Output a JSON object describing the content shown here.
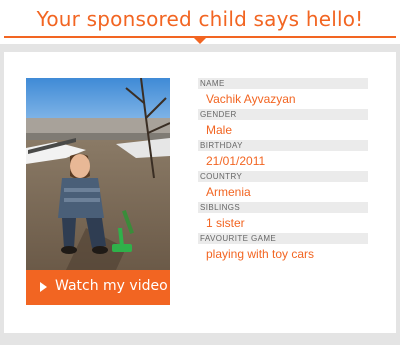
{
  "header": {
    "title": "Your sponsored child says hello!"
  },
  "photo": {
    "alt": "Child playing outdoors with a green toy"
  },
  "video_button": {
    "icon": "play-icon",
    "label": "Watch my video"
  },
  "details": [
    {
      "label": "NAME",
      "value": "Vachik Ayvazyan"
    },
    {
      "label": "GENDER",
      "value": "Male"
    },
    {
      "label": "BIRTHDAY",
      "value": "21/01/2011"
    },
    {
      "label": "COUNTRY",
      "value": "Armenia"
    },
    {
      "label": "SIBLINGS",
      "value": "1 sister"
    },
    {
      "label": "FAVOURITE GAME",
      "value": "playing with toy cars"
    }
  ],
  "colors": {
    "accent": "#f26522",
    "background": "#e4e4e4",
    "card": "#ffffff",
    "label_bg": "#ebebeb"
  }
}
